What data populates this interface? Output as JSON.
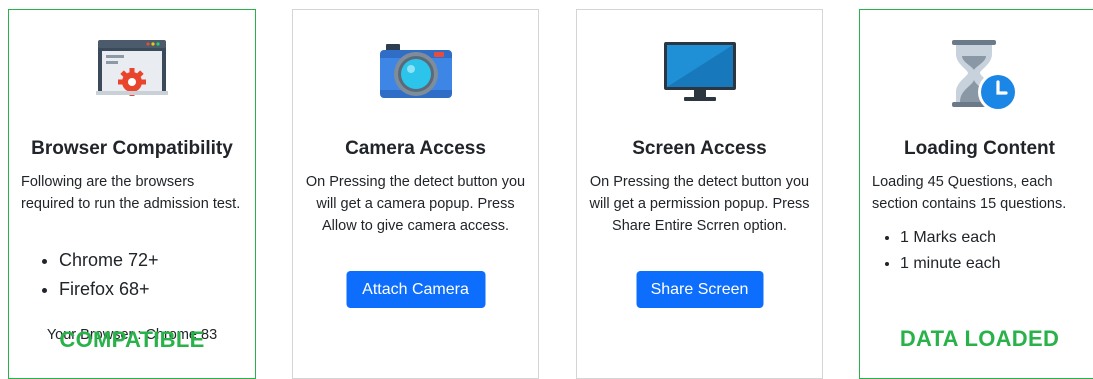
{
  "cards": {
    "browser": {
      "title": "Browser Compatibility",
      "description": "Following are the browsers required to run the admission test.",
      "items": [
        "Chrome 72+",
        "Firefox 68+"
      ],
      "your_browser": "Your Browser : Chrome 83",
      "status": "COMPATIBLE",
      "status_color": "#2ab24a",
      "icon": "browser-settings-icon"
    },
    "camera": {
      "title": "Camera Access",
      "description": "On Pressing the detect button you will get a camera popup. Press Allow to give camera access.",
      "button_label": "Attach Camera",
      "icon": "camera-icon"
    },
    "screen": {
      "title": "Screen Access",
      "description": "On Pressing the detect button you will get a permission popup. Press Share Entire Scrren option.",
      "button_label": "Share Screen",
      "icon": "monitor-icon"
    },
    "loading": {
      "title": "Loading Content",
      "description": "Loading 45 Questions, each section contains 15 questions.",
      "items": [
        "1 Marks each",
        "1 minute each"
      ],
      "status": "DATA LOADED",
      "status_color": "#2ab24a",
      "icon": "hourglass-clock-icon"
    }
  },
  "colors": {
    "accent": "#0d6efd",
    "success": "#2ab24a"
  }
}
